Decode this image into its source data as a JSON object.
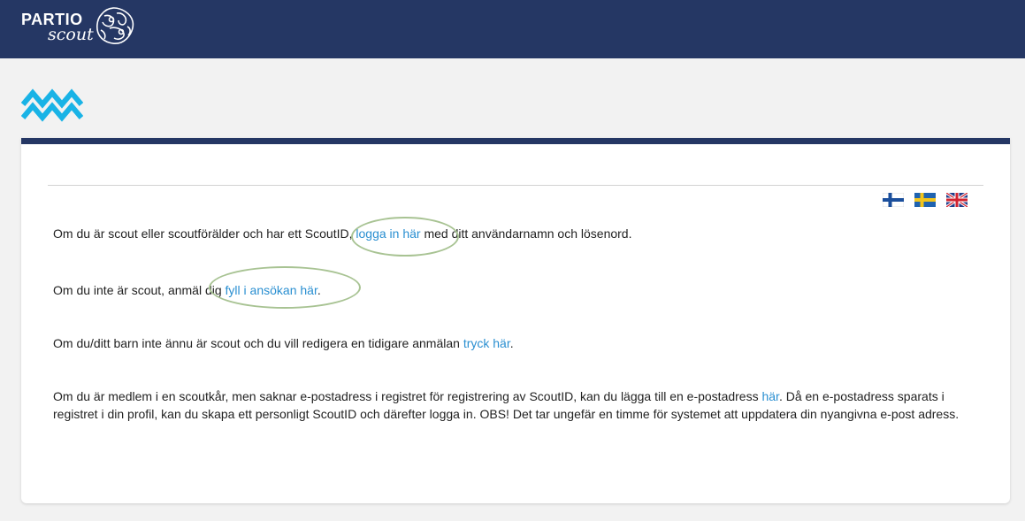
{
  "header": {
    "logo_top": "PARTIO",
    "logo_bottom": "scout"
  },
  "languages": [
    {
      "code": "fi",
      "icon": "finland-flag-icon"
    },
    {
      "code": "sv",
      "icon": "sweden-flag-icon"
    },
    {
      "code": "en",
      "icon": "uk-flag-icon"
    }
  ],
  "content": {
    "p1": {
      "before": "Om du är scout eller scoutförälder och har ett ScoutID, ",
      "link": "logga in här",
      "after": " med ditt användarnamn och lösenord."
    },
    "p2": {
      "before": "Om du inte är scout, anmäl dig ",
      "link": "fyll i ansökan här",
      "after": "."
    },
    "p3": {
      "before": "Om du/ditt barn inte ännu är scout och du vill redigera en tidigare anmälan ",
      "link": "tryck här",
      "after": "."
    },
    "p4": {
      "before": "Om du är medlem i en scoutkår, men saknar e-postadress i registret för registrering av ScoutID, kan du lägga till en e-postadress ",
      "link": "här",
      "after": ". Då en e-postadress sparats i registret i din profil, kan du skapa ett personligt ScoutID och därefter logga in. OBS! Det tar ungefär en timme för systemet att uppdatera din nyangivna e-post adress."
    }
  },
  "colors": {
    "header_bg": "#253764",
    "link": "#2a8fd1",
    "wave_icon": "#19b3e6",
    "annotation": "#a8c393"
  }
}
